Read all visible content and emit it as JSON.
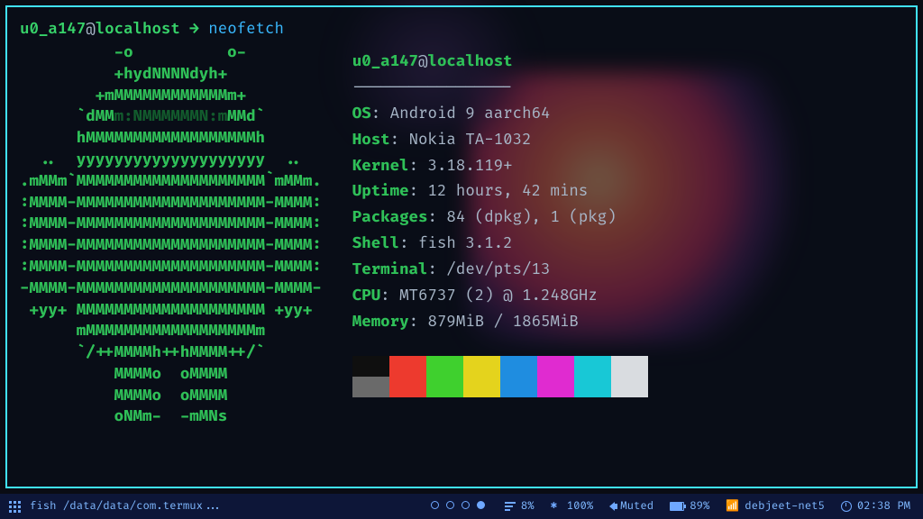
{
  "prompt": {
    "user": "u0_a147",
    "host": "localhost",
    "at": "@",
    "arrow": "→",
    "command": "neofetch"
  },
  "ascii": [
    "          -o          o-",
    "          +hydNNNNdyh+",
    "        +mMMMMMMMMMMMMm+",
    "      `dMM§m:NMMMMMMN:m§MMd`",
    "      hMMMMMMMMMMMMMMMMMMh",
    "  ..  yyyyyyyyyyyyyyyyyyyy  ..",
    ".mMMm`MMMMMMMMMMMMMMMMMMMM`mMMm.",
    ":MMMM-MMMMMMMMMMMMMMMMMMMM-MMMM:",
    ":MMMM-MMMMMMMMMMMMMMMMMMMM-MMMM:",
    ":MMMM-MMMMMMMMMMMMMMMMMMMM-MMMM:",
    ":MMMM-MMMMMMMMMMMMMMMMMMMM-MMMM:",
    "-MMMM-MMMMMMMMMMMMMMMMMMMM-MMMM-",
    " +yy+ MMMMMMMMMMMMMMMMMMMM +yy+",
    "      mMMMMMMMMMMMMMMMMMMm",
    "      `/++MMMMh++hMMMM++/`",
    "          MMMMo  oMMMM",
    "          MMMMo  oMMMM",
    "          oNMm-  -mMNs"
  ],
  "info": {
    "user": "u0_a147",
    "host": "localhost",
    "dashes": "-----------------",
    "rows": [
      {
        "k": "OS",
        "v": "Android 9 aarch64"
      },
      {
        "k": "Host",
        "v": "Nokia TA-1032"
      },
      {
        "k": "Kernel",
        "v": "3.18.119+"
      },
      {
        "k": "Uptime",
        "v": "12 hours, 42 mins"
      },
      {
        "k": "Packages",
        "v": "84 (dpkg), 1 (pkg)"
      },
      {
        "k": "Shell",
        "v": "fish 3.1.2"
      },
      {
        "k": "Terminal",
        "v": "/dev/pts/13"
      },
      {
        "k": "CPU",
        "v": "MT6737 (2) @ 1.248GHz"
      },
      {
        "k": "Memory",
        "v": "879MiB / 1865MiB"
      }
    ]
  },
  "swatches_top": [
    "#0f0f0f",
    "#ed3a2e",
    "#3fd02e",
    "#e4d31d",
    "#1f8de0",
    "#e02bd0",
    "#18c8d6",
    "#d9dce0"
  ],
  "swatches_bot": [
    "#6a6a6a",
    "#ed3a2e",
    "#3fd02e",
    "#e4d31d",
    "#1f8de0",
    "#e02bd0",
    "#18c8d6",
    "#d9dce0"
  ],
  "bar": {
    "task": "fish /data/data/com.termux...",
    "cpu": "8%",
    "brightness": "100%",
    "audio": "Muted",
    "battery": "89%",
    "wifi": "debjeet-net5",
    "time": "02:38 PM"
  }
}
